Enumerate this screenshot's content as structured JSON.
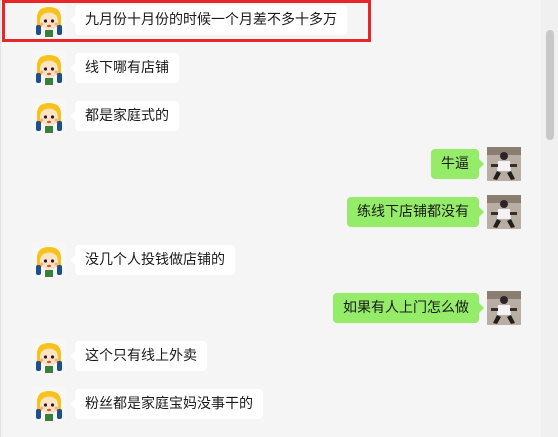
{
  "colors": {
    "sent_bubble": "#95ec69",
    "received_bubble": "#ffffff",
    "highlight_border": "#e8262a"
  },
  "messages": [
    {
      "side": "left",
      "text": "九月份十月份的时候一个月差不多十多万",
      "avatar": "cartoon-girl-avatar"
    },
    {
      "side": "left",
      "text": "线下哪有店铺",
      "avatar": "cartoon-girl-avatar"
    },
    {
      "side": "left",
      "text": "都是家庭式的",
      "avatar": "cartoon-girl-avatar"
    },
    {
      "side": "right",
      "text": "牛逼",
      "avatar": "user-photo-avatar"
    },
    {
      "side": "right",
      "text": "练线下店铺都没有",
      "avatar": "user-photo-avatar"
    },
    {
      "side": "left",
      "text": "没几个人投钱做店铺的",
      "avatar": "cartoon-girl-avatar"
    },
    {
      "side": "right",
      "text": "如果有人上门怎么做",
      "avatar": "user-photo-avatar"
    },
    {
      "side": "left",
      "text": "这个只有线上外卖",
      "avatar": "cartoon-girl-avatar"
    },
    {
      "side": "left",
      "text": "粉丝都是家庭宝妈没事干的",
      "avatar": "cartoon-girl-avatar"
    }
  ]
}
